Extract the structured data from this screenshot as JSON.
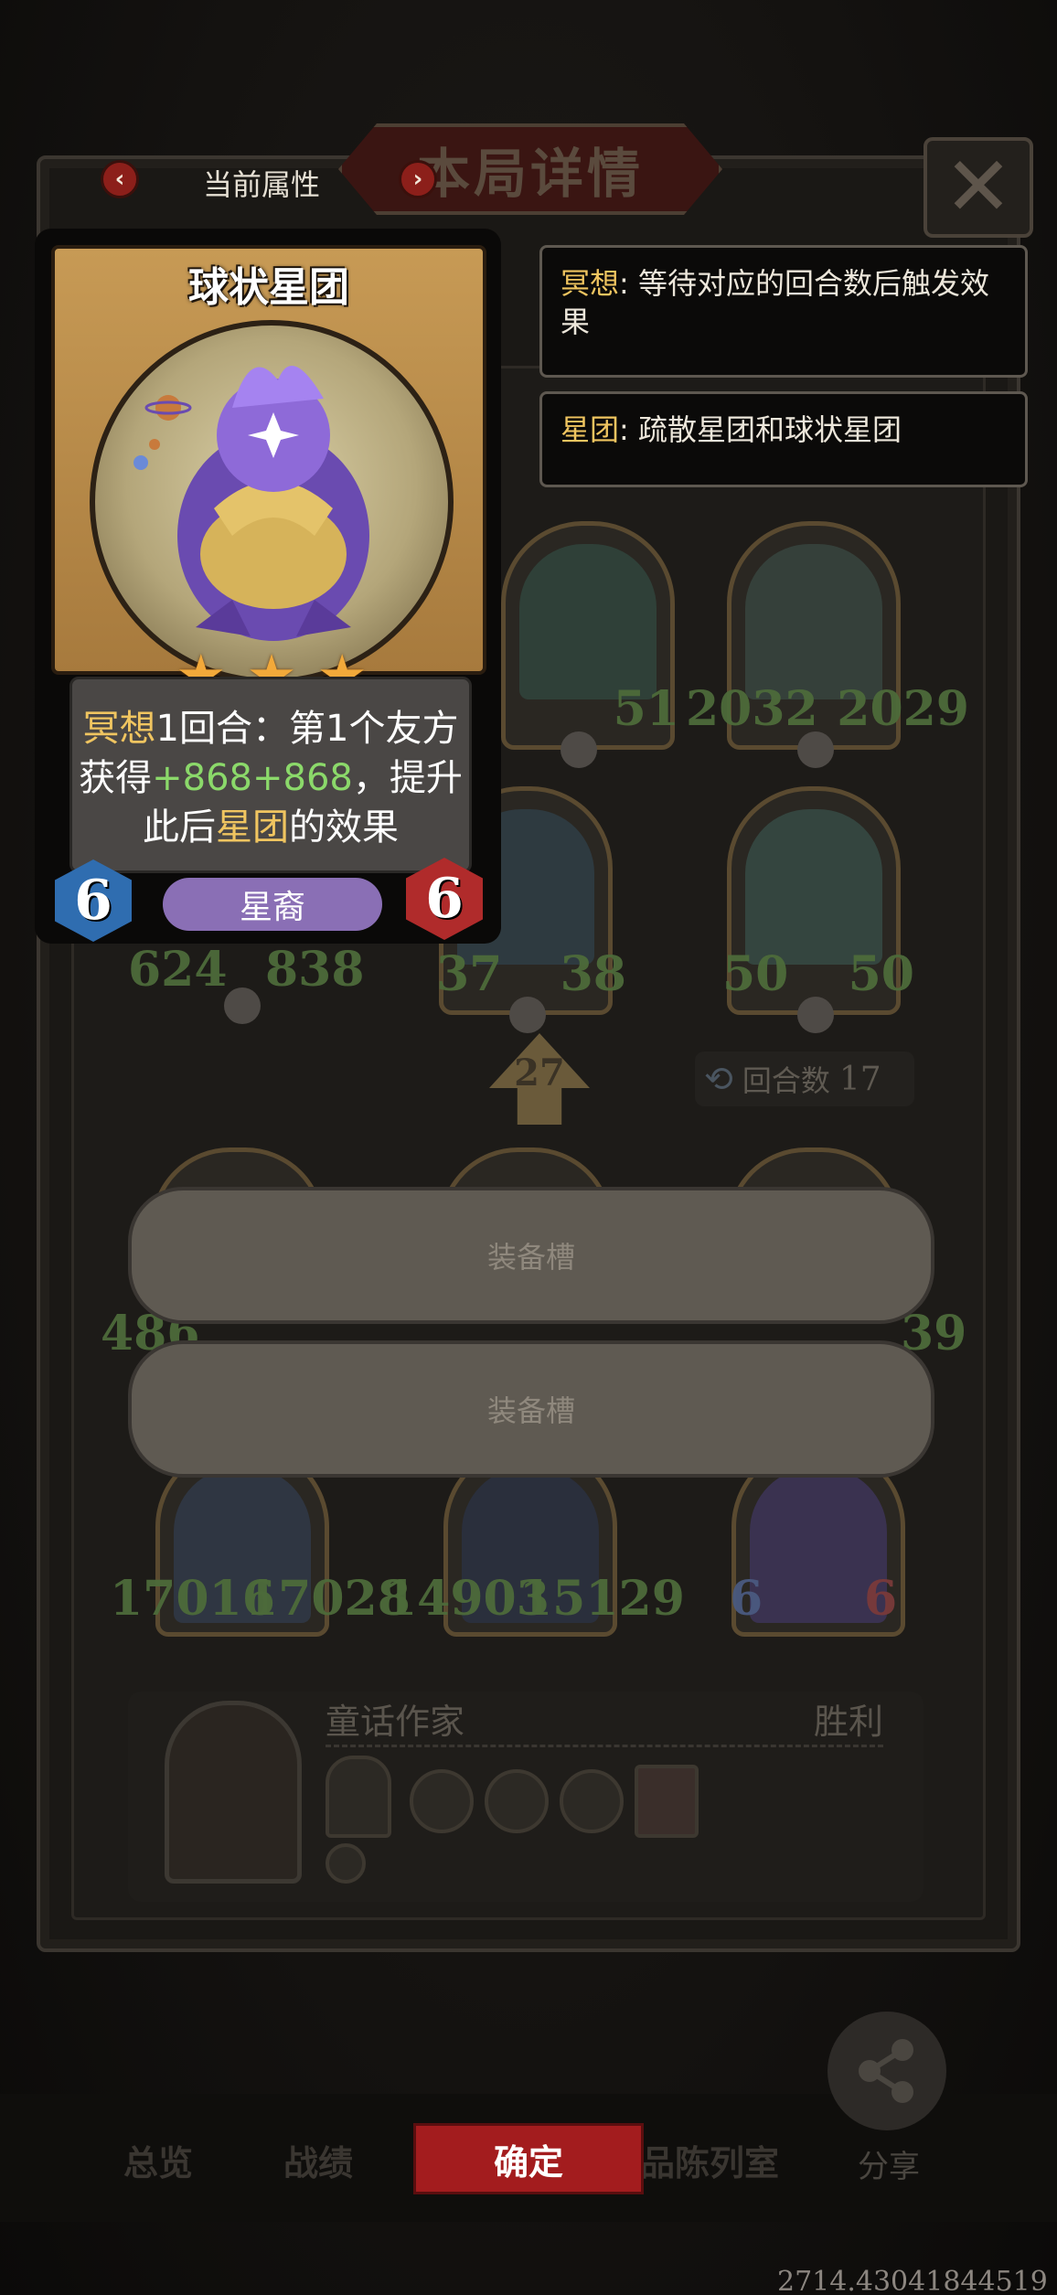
{
  "header": {
    "title": "本局详情",
    "attr_label": "当前属性",
    "prev_symbol": "‹",
    "next_symbol": "›",
    "close_symbol": "✕"
  },
  "card": {
    "name": "球状星团",
    "stars": 3,
    "desc": {
      "kw1": "冥想",
      "p1": "1回合：第1个友方获得",
      "v1": "+868",
      "v2": "+868",
      "p2": "，提升此后",
      "kw2": "星团",
      "p3": "的效果"
    },
    "tribe": "星裔",
    "attack": "6",
    "health": "6"
  },
  "tooltips": [
    {
      "keyword": "冥想",
      "text": ": 等待对应的回合数后触发效果"
    },
    {
      "keyword": "星团",
      "text": ": 疏散星团和球状星团"
    }
  ],
  "board": {
    "row1": [
      {
        "atk": "",
        "hp": "51"
      },
      {
        "atk": "2032",
        "hp": "2029"
      }
    ],
    "row2": [
      {
        "atk": "624",
        "hp": "838"
      },
      {
        "atk": "37",
        "hp": "38"
      },
      {
        "atk": "50",
        "hp": "50"
      }
    ],
    "turn_number": "27",
    "round_label": "回合数",
    "round_value": "17",
    "row3_left": "486",
    "row3_right": "39",
    "row4": [
      {
        "atk": "17016",
        "hp": "17028"
      },
      {
        "atk": "14903",
        "hp": "15129"
      },
      {
        "atk": "6",
        "hp": "6"
      }
    ]
  },
  "equip_slots": [
    "装备槽",
    "装备槽"
  ],
  "player": {
    "name": "童话作家",
    "result": "胜利"
  },
  "bottom": {
    "tabs": [
      "总览",
      "战绩",
      "",
      "品陈列室"
    ],
    "confirm": "确定",
    "share": "分享"
  },
  "coords_text": "2714.43041844519",
  "colors": {
    "accent_red": "#a31c1e",
    "keyword_gold": "#f0c560",
    "value_green": "#8bd96a",
    "tribe_purple": "#8a6fb5",
    "attack_blue": "#2f6db0",
    "health_red": "#b02b2b"
  }
}
